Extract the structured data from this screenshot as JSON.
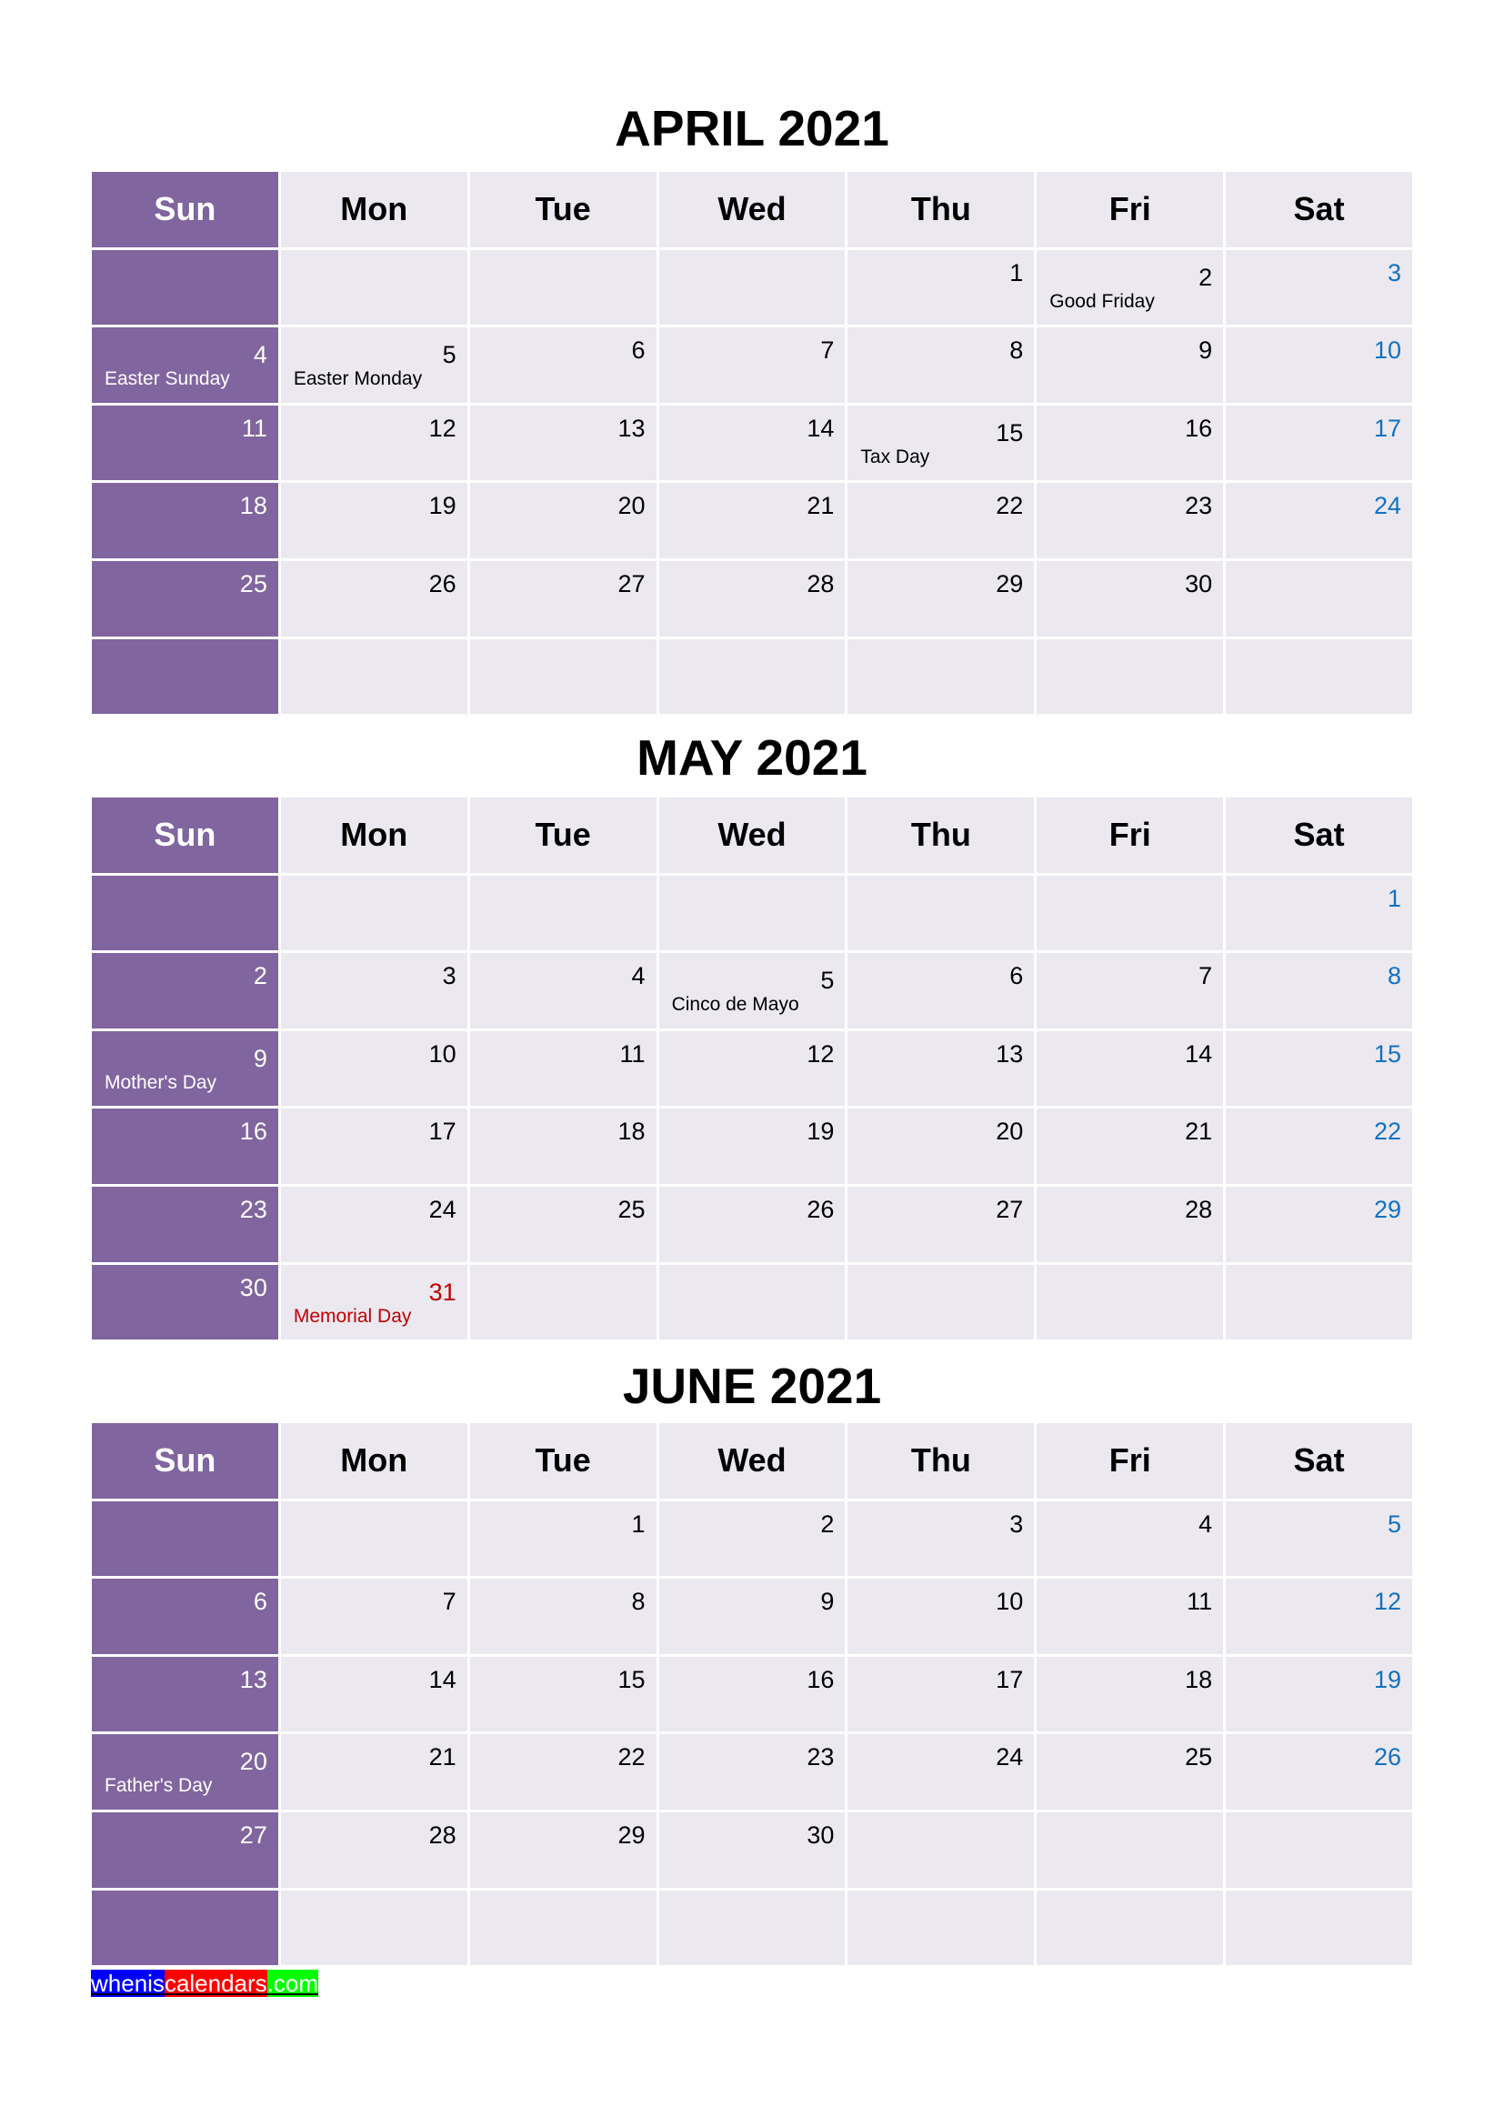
{
  "weekdays": [
    "Sun",
    "Mon",
    "Tue",
    "Wed",
    "Thu",
    "Fri",
    "Sat"
  ],
  "colors": {
    "sunday_bg": "#80659f",
    "cell_bg": "#ebe9ef",
    "saturday_text": "#1171c2",
    "federal_holiday_text": "#c00000"
  },
  "months": [
    {
      "title": "APRIL 2021",
      "weeks": [
        [
          {
            "d": ""
          },
          {
            "d": ""
          },
          {
            "d": ""
          },
          {
            "d": ""
          },
          {
            "d": "1"
          },
          {
            "d": "2",
            "h": "Good Friday"
          },
          {
            "d": "3"
          }
        ],
        [
          {
            "d": "4",
            "h": "Easter Sunday"
          },
          {
            "d": "5",
            "h": "Easter Monday"
          },
          {
            "d": "6"
          },
          {
            "d": "7"
          },
          {
            "d": "8"
          },
          {
            "d": "9"
          },
          {
            "d": "10"
          }
        ],
        [
          {
            "d": "11"
          },
          {
            "d": "12"
          },
          {
            "d": "13"
          },
          {
            "d": "14"
          },
          {
            "d": "15",
            "h": "Tax Day"
          },
          {
            "d": "16"
          },
          {
            "d": "17"
          }
        ],
        [
          {
            "d": "18"
          },
          {
            "d": "19"
          },
          {
            "d": "20"
          },
          {
            "d": "21"
          },
          {
            "d": "22"
          },
          {
            "d": "23"
          },
          {
            "d": "24"
          }
        ],
        [
          {
            "d": "25"
          },
          {
            "d": "26"
          },
          {
            "d": "27"
          },
          {
            "d": "28"
          },
          {
            "d": "29"
          },
          {
            "d": "30"
          },
          {
            "d": ""
          }
        ],
        [
          {
            "d": ""
          },
          {
            "d": ""
          },
          {
            "d": ""
          },
          {
            "d": ""
          },
          {
            "d": ""
          },
          {
            "d": ""
          },
          {
            "d": ""
          }
        ]
      ]
    },
    {
      "title": "MAY 2021",
      "weeks": [
        [
          {
            "d": ""
          },
          {
            "d": ""
          },
          {
            "d": ""
          },
          {
            "d": ""
          },
          {
            "d": ""
          },
          {
            "d": ""
          },
          {
            "d": "1"
          }
        ],
        [
          {
            "d": "2"
          },
          {
            "d": "3"
          },
          {
            "d": "4"
          },
          {
            "d": "5",
            "h": "Cinco de Mayo"
          },
          {
            "d": "6"
          },
          {
            "d": "7"
          },
          {
            "d": "8"
          }
        ],
        [
          {
            "d": "9",
            "h": "Mother's Day"
          },
          {
            "d": "10"
          },
          {
            "d": "11"
          },
          {
            "d": "12"
          },
          {
            "d": "13"
          },
          {
            "d": "14"
          },
          {
            "d": "15"
          }
        ],
        [
          {
            "d": "16"
          },
          {
            "d": "17"
          },
          {
            "d": "18"
          },
          {
            "d": "19"
          },
          {
            "d": "20"
          },
          {
            "d": "21"
          },
          {
            "d": "22"
          }
        ],
        [
          {
            "d": "23"
          },
          {
            "d": "24"
          },
          {
            "d": "25"
          },
          {
            "d": "26"
          },
          {
            "d": "27"
          },
          {
            "d": "28"
          },
          {
            "d": "29"
          }
        ],
        [
          {
            "d": "30"
          },
          {
            "d": "31",
            "h": "Memorial Day",
            "red": true
          },
          {
            "d": ""
          },
          {
            "d": ""
          },
          {
            "d": ""
          },
          {
            "d": ""
          },
          {
            "d": ""
          }
        ]
      ]
    },
    {
      "title": "JUNE 2021",
      "weeks": [
        [
          {
            "d": ""
          },
          {
            "d": ""
          },
          {
            "d": "1"
          },
          {
            "d": "2"
          },
          {
            "d": "3"
          },
          {
            "d": "4"
          },
          {
            "d": "5"
          }
        ],
        [
          {
            "d": "6"
          },
          {
            "d": "7"
          },
          {
            "d": "8"
          },
          {
            "d": "9"
          },
          {
            "d": "10"
          },
          {
            "d": "11"
          },
          {
            "d": "12"
          }
        ],
        [
          {
            "d": "13"
          },
          {
            "d": "14"
          },
          {
            "d": "15"
          },
          {
            "d": "16"
          },
          {
            "d": "17"
          },
          {
            "d": "18"
          },
          {
            "d": "19"
          }
        ],
        [
          {
            "d": "20",
            "h": "Father's Day"
          },
          {
            "d": "21"
          },
          {
            "d": "22"
          },
          {
            "d": "23"
          },
          {
            "d": "24"
          },
          {
            "d": "25"
          },
          {
            "d": "26"
          }
        ],
        [
          {
            "d": "27"
          },
          {
            "d": "28"
          },
          {
            "d": "29"
          },
          {
            "d": "30"
          },
          {
            "d": ""
          },
          {
            "d": ""
          },
          {
            "d": ""
          }
        ],
        [
          {
            "d": ""
          },
          {
            "d": ""
          },
          {
            "d": ""
          },
          {
            "d": ""
          },
          {
            "d": ""
          },
          {
            "d": ""
          },
          {
            "d": ""
          }
        ]
      ]
    }
  ],
  "footer": {
    "parts": [
      {
        "text": "whenis",
        "bg": "#0000ff",
        "color": "#ffffff"
      },
      {
        "text": "calendars",
        "bg": "#ff0000",
        "color": "#ffffff"
      },
      {
        "text": ".com",
        "bg": "#00ff00",
        "color": "#ffffff"
      }
    ]
  }
}
